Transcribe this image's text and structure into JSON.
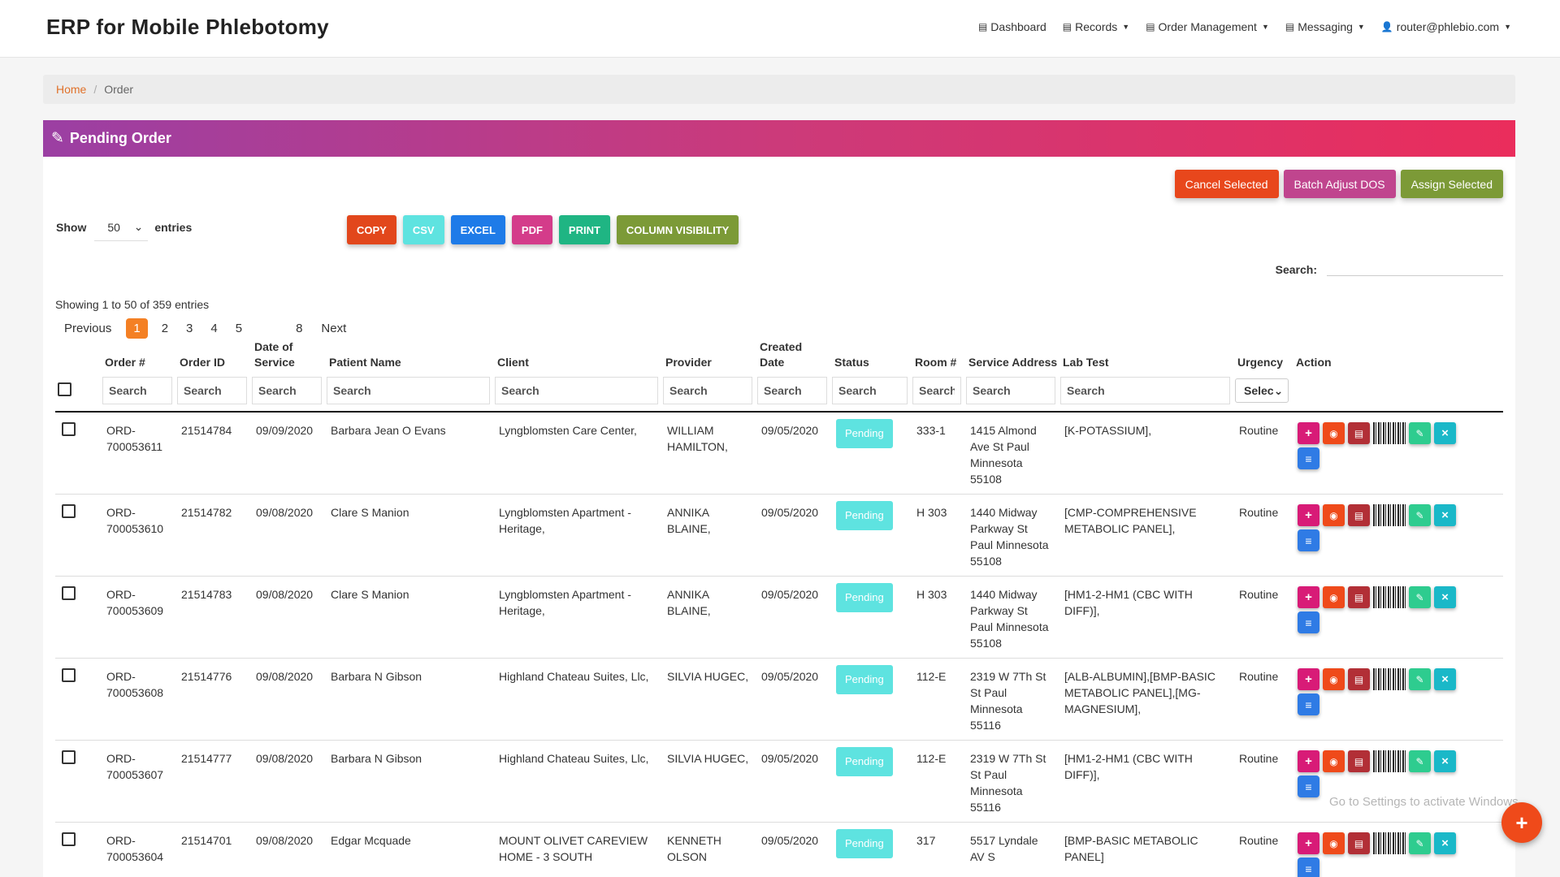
{
  "app": {
    "brand": "ERP for Mobile Phlebotomy"
  },
  "nav": {
    "items": [
      {
        "label": "Dashboard",
        "icon": "dashboard-icon",
        "dropdown": false
      },
      {
        "label": "Records",
        "icon": "records-icon",
        "dropdown": true
      },
      {
        "label": "Order Management",
        "icon": "orders-icon",
        "dropdown": true
      },
      {
        "label": "Messaging",
        "icon": "messaging-icon",
        "dropdown": true
      },
      {
        "label": "router@phlebio.com",
        "icon": "user-icon",
        "dropdown": true
      }
    ]
  },
  "breadcrumb": {
    "home": "Home",
    "current": "Order"
  },
  "panel": {
    "title": "Pending Order",
    "icon": "edit-icon"
  },
  "actions": {
    "cancel_selected": "Cancel Selected",
    "batch_adjust": "Batch Adjust DOS",
    "assign_selected": "Assign Selected",
    "colors": {
      "cancel": "#e8471c",
      "batch": "#c0458e",
      "assign": "#7c9a37"
    }
  },
  "entries": {
    "show_label": "Show",
    "value": "50",
    "suffix": "entries"
  },
  "export": {
    "buttons": [
      {
        "label": "COPY",
        "color": "#e2471c"
      },
      {
        "label": "CSV",
        "color": "#5ee3e0"
      },
      {
        "label": "EXCEL",
        "color": "#1e7be8"
      },
      {
        "label": "PDF",
        "color": "#d43c8a"
      },
      {
        "label": "PRINT",
        "color": "#1fb583"
      },
      {
        "label": "COLUMN VISIBILITY",
        "color": "#7c9a37"
      }
    ]
  },
  "search": {
    "label": "Search:"
  },
  "info": "Showing 1 to 50 of 359 entries",
  "pagination": {
    "previous": "Previous",
    "pages": [
      "1",
      "2",
      "3",
      "4",
      "5",
      "8"
    ],
    "active": "1",
    "next": "Next"
  },
  "table": {
    "columns": [
      {
        "key": "order_no",
        "label": "Order #"
      },
      {
        "key": "order_id",
        "label": "Order ID"
      },
      {
        "key": "dos",
        "label": "Date of Service"
      },
      {
        "key": "patient",
        "label": "Patient Name"
      },
      {
        "key": "client",
        "label": "Client"
      },
      {
        "key": "provider",
        "label": "Provider"
      },
      {
        "key": "created",
        "label": "Created Date"
      },
      {
        "key": "status",
        "label": "Status"
      },
      {
        "key": "room",
        "label": "Room #"
      },
      {
        "key": "address",
        "label": "Service Address"
      },
      {
        "key": "labtest",
        "label": "Lab Test"
      },
      {
        "key": "urgency",
        "label": "Urgency"
      },
      {
        "key": "action",
        "label": "Action"
      }
    ],
    "filter_placeholder": "Search",
    "urgency_select": "Selec",
    "rows": [
      {
        "order_no": "ORD-700053611",
        "order_id": "21514784",
        "dos": "09/09/2020",
        "patient": "Barbara Jean O Evans",
        "client": "Lyngblomsten Care Center,",
        "provider": "WILLIAM HAMILTON,",
        "created": "09/05/2020",
        "status": "Pending",
        "room": "333-1",
        "address": "1415 Almond Ave St Paul Minnesota 55108",
        "labtest": "[K-POTASSIUM],",
        "urgency": "Routine"
      },
      {
        "order_no": "ORD-700053610",
        "order_id": "21514782",
        "dos": "09/08/2020",
        "patient": "Clare S Manion",
        "client": "Lyngblomsten Apartment - Heritage,",
        "provider": "ANNIKA BLAINE,",
        "created": "09/05/2020",
        "status": "Pending",
        "room": "H 303",
        "address": "1440 Midway Parkway St Paul Minnesota 55108",
        "labtest": "[CMP-COMPREHENSIVE METABOLIC PANEL],",
        "urgency": "Routine"
      },
      {
        "order_no": "ORD-700053609",
        "order_id": "21514783",
        "dos": "09/08/2020",
        "patient": "Clare S Manion",
        "client": "Lyngblomsten Apartment - Heritage,",
        "provider": "ANNIKA BLAINE,",
        "created": "09/05/2020",
        "status": "Pending",
        "room": "H 303",
        "address": "1440 Midway Parkway St Paul Minnesota 55108",
        "labtest": "[HM1-2-HM1 (CBC WITH DIFF)],",
        "urgency": "Routine"
      },
      {
        "order_no": "ORD-700053608",
        "order_id": "21514776",
        "dos": "09/08/2020",
        "patient": "Barbara N Gibson",
        "client": "Highland Chateau Suites, Llc,",
        "provider": "SILVIA HUGEC,",
        "created": "09/05/2020",
        "status": "Pending",
        "room": "112-E",
        "address": "2319 W 7Th St St Paul Minnesota 55116",
        "labtest": "[ALB-ALBUMIN],[BMP-BASIC METABOLIC PANEL],[MG-MAGNESIUM],",
        "urgency": "Routine"
      },
      {
        "order_no": "ORD-700053607",
        "order_id": "21514777",
        "dos": "09/08/2020",
        "patient": "Barbara N Gibson",
        "client": "Highland Chateau Suites, Llc,",
        "provider": "SILVIA HUGEC,",
        "created": "09/05/2020",
        "status": "Pending",
        "room": "112-E",
        "address": "2319 W 7Th St St Paul Minnesota 55116",
        "labtest": "[HM1-2-HM1 (CBC WITH DIFF)],",
        "urgency": "Routine"
      },
      {
        "order_no": "ORD-700053604",
        "order_id": "21514701",
        "dos": "09/08/2020",
        "patient": "Edgar Mcquade",
        "client": "MOUNT OLIVET CAREVIEW HOME - 3 SOUTH",
        "provider": "KENNETH OLSON",
        "created": "09/05/2020",
        "status": "Pending",
        "room": "317",
        "address": "5517 Lyndale AV S",
        "labtest": "[BMP-BASIC METABOLIC PANEL]",
        "urgency": "Routine"
      }
    ]
  },
  "watermark": "Go to Settings to activate Windows.",
  "fab": {
    "icon": "plus-icon"
  }
}
